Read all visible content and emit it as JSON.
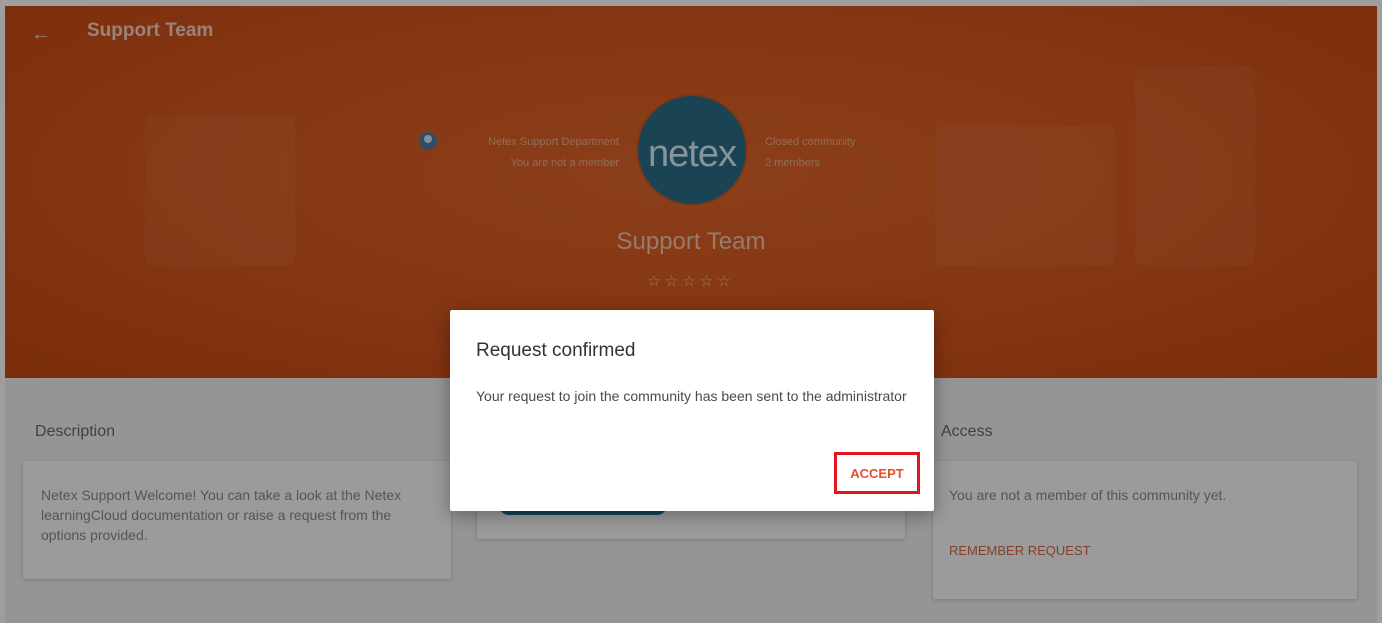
{
  "topbar": {
    "back_icon": "arrow-left-icon",
    "title": "Support Team"
  },
  "community": {
    "owner_name": "Netex Support Department",
    "membership_status": "You are not a member",
    "privacy": "Closed community",
    "members_count": "2 members",
    "logo_text": "netex",
    "name": "Support Team",
    "rating_stars": "☆☆☆☆☆",
    "rating_value": 0,
    "rating_max": 5
  },
  "description": {
    "heading": "Description",
    "text": "Netex Support Welcome! You can take a look at the Netex learningCloud documentation or raise a request from the options provided."
  },
  "access": {
    "heading": "Access",
    "text": "You are not a member of this community yet.",
    "remember_label": "REMEMBER REQUEST"
  },
  "dialog": {
    "title": "Request confirmed",
    "message": "Your request to join the community has been sent to the administrator",
    "accept_label": "ACCEPT"
  },
  "colors": {
    "hero": "#d95a20",
    "accent": "#e7512a",
    "highlight_border": "#e0161f",
    "logo": "#2a6f87"
  }
}
